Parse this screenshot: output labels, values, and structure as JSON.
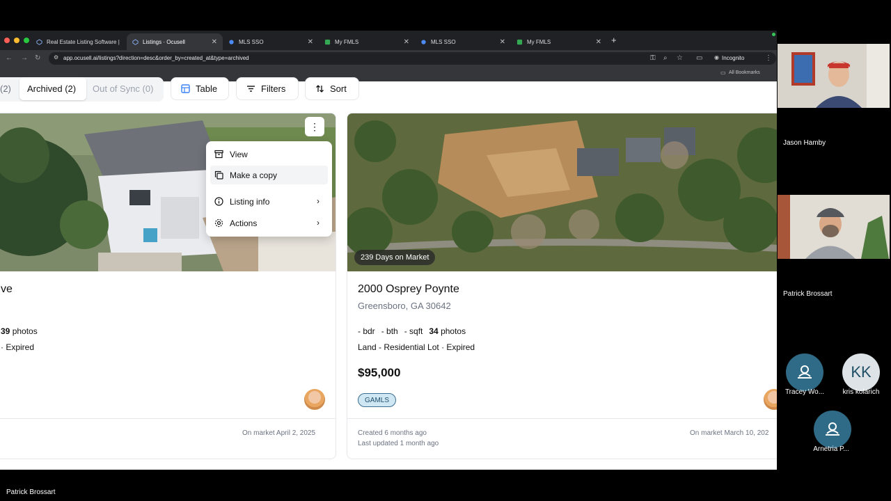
{
  "browser": {
    "tabs": [
      {
        "label": "Real Estate Listing Software |"
      },
      {
        "label": "Listings · Ocusell"
      },
      {
        "label": "MLS SSO"
      },
      {
        "label": "My FMLS"
      },
      {
        "label": "MLS SSO"
      },
      {
        "label": "My FMLS"
      }
    ],
    "url": "app.ocusell.ai/listings?direction=desc&order_by=created_at&type=archived",
    "incognito_label": "Incognito",
    "bookmarks_label": "All Bookmarks"
  },
  "filters": {
    "count_prev": "(2)",
    "archived": "Archived (2)",
    "out_of_sync": "Out of Sync (0)",
    "table": "Table",
    "filters": "Filters",
    "sort": "Sort"
  },
  "menu": {
    "view": "View",
    "make_copy": "Make a copy",
    "listing_info": "Listing info",
    "actions": "Actions"
  },
  "listings": [
    {
      "title_fragment": "ve",
      "photos_count": "39",
      "photos_label": "photos",
      "status_fragment": "· Expired",
      "on_market": "On market April 2, 2025"
    },
    {
      "days_on_market": "239 Days on Market",
      "title": "2000 Osprey Poynte",
      "location": "Greensboro, GA 30642",
      "bdr": "- bdr",
      "bth": "- bth",
      "sqft": "- sqft",
      "photos_count": "34",
      "photos_label": "photos",
      "type_status": "Land - Residential Lot · Expired",
      "price": "$95,000",
      "tag": "GAMLS",
      "created": "Created 6 months ago",
      "updated": "Last updated 1 month ago",
      "on_market": "On market March 10, 202"
    }
  ],
  "participants": [
    {
      "name": "Jason Hamby"
    },
    {
      "name": "Patrick Brossart"
    },
    {
      "name": "Tracey Wo...",
      "initials": ""
    },
    {
      "name": "kris kolarich",
      "initials": "KK"
    },
    {
      "name": "Arnetria P...",
      "initials": ""
    }
  ],
  "footer": {
    "presenter": "Patrick Brossart"
  }
}
